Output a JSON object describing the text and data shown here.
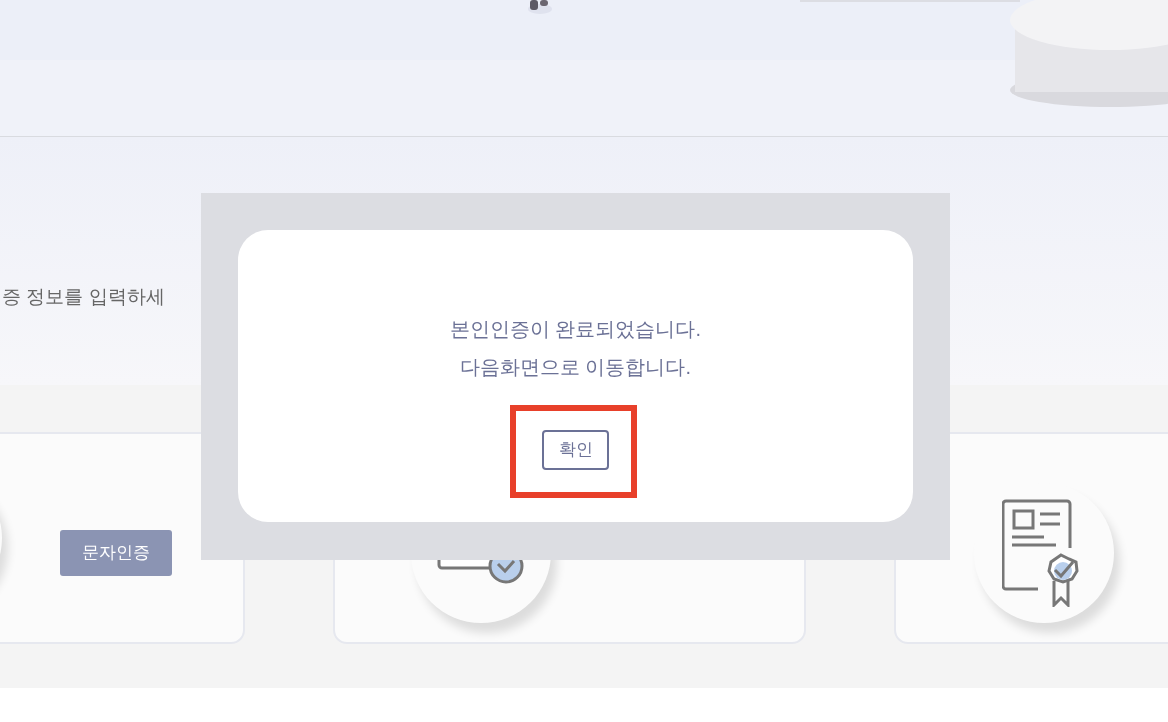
{
  "intro": {
    "text": "증 정보를 입력하세"
  },
  "methods": [
    {
      "kind": "phone",
      "button": "문자인증"
    },
    {
      "kind": "card"
    },
    {
      "kind": "certificate"
    }
  ],
  "dialog": {
    "lines": [
      "본인인증이 완료되었습니다.",
      "다음화면으로 이동합니다."
    ],
    "confirm": "확인",
    "highlighted": true
  }
}
